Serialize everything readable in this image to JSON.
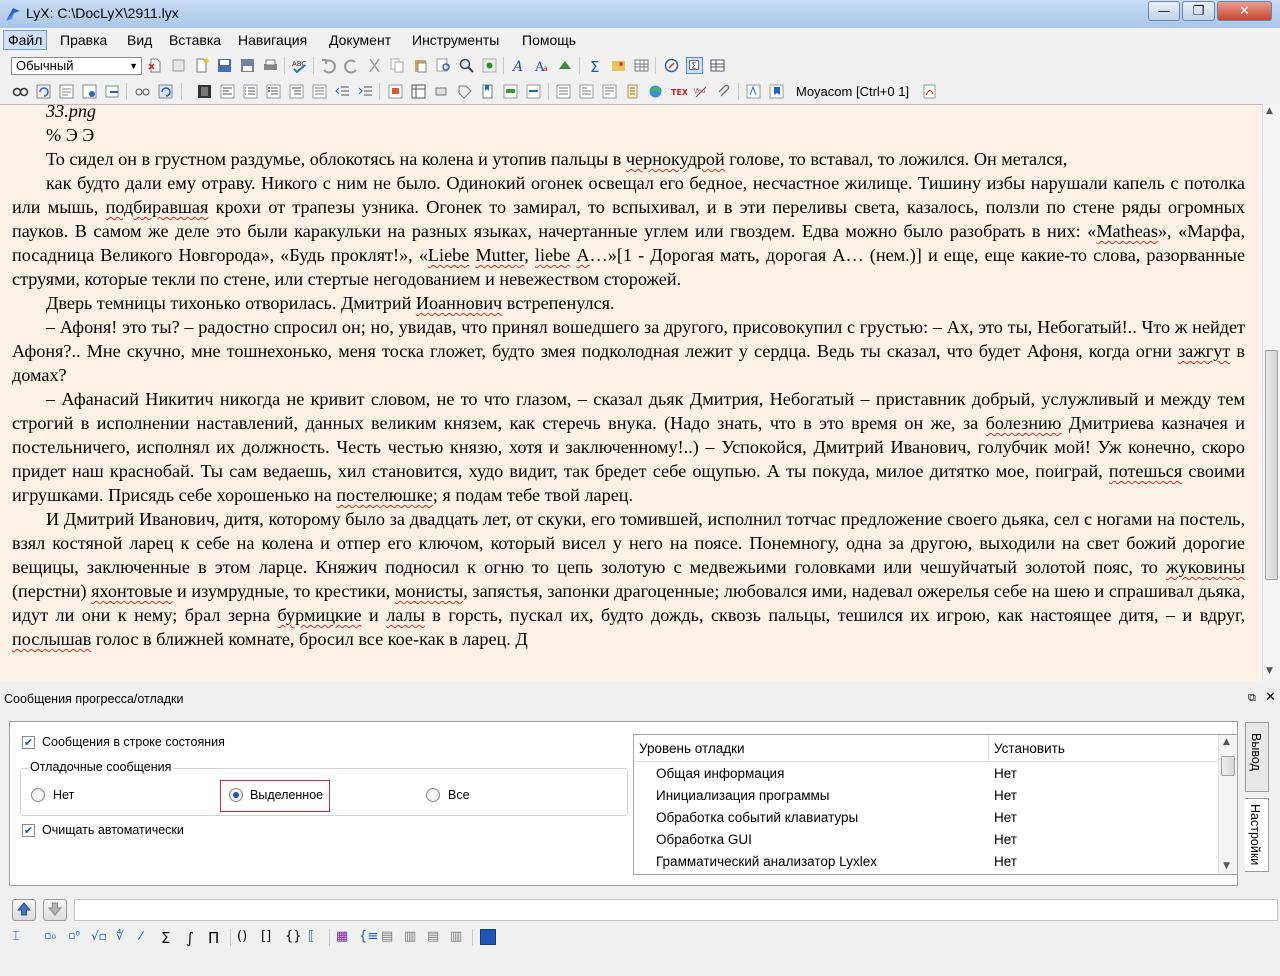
{
  "window": {
    "title": "LyX: C:\\DocLyX\\2911.lyx",
    "minimize": "—",
    "maximize": "❐",
    "close": "✕"
  },
  "menu": [
    "Файл",
    "Правка",
    "Вид",
    "Вставка",
    "Навигация",
    "Документ",
    "Инструменты",
    "Помощь"
  ],
  "toolbar": {
    "style_value": "Обычный",
    "workarea_label": "Moyacom [Ctrl+0 1]"
  },
  "document": {
    "top_partial": "33.png",
    "line2": "% Э Э",
    "p1": [
      "То сидел он в грустном раздумье, облокотясь на колена и утопив пальцы в ",
      "чернокудрой",
      " голове, то вставал, то ложился. Он метался,"
    ],
    "p2": [
      "как будто дали ему отраву. Никого с ним не было. Одинокий огонек освещал его бедное, несчастное жилище. Тишину избы нарушали капель с потолка или мышь, ",
      "подбиравшая",
      " крохи от трапезы узника. Огонек то замирал, то вспыхивал, и в эти переливы света, казалось, ползли по стене ряды огромных пауков. В самом же деле это были каракульки на разных языках, начертанные углем или гвоздем. Едва можно было разобрать в них: «",
      "Matheas",
      "», «Марфа, посадница Великого Новгорода», «Будь проклят!», «",
      "Liebe",
      " ",
      "Mutter",
      ", ",
      "liebe",
      " ",
      "А",
      "…»[1 - Дорогая мать, дорогая А… (нем.)] и еще, еще какие-то слова, разорванные струями, которые текли по стене, или стертые негодованием и невежеством сторожей."
    ],
    "p3": [
      "Дверь темницы тихонько отворилась. Дмитрий ",
      "Иоаннович",
      " встрепенулся."
    ],
    "p4": [
      "– Афоня! это ты? – радостно спросил он; но, увидав, что принял вошедшего за другого, присовокупил с грустью: – Ах, это ты, Небогатый!.. Что ж нейдет Афоня?.. Мне скучно, мне тошнехонько, меня тоска гложет, будто змея подколодная лежит у сердца. Ведь ты сказал, что будет Афоня, когда огни ",
      "зажгут",
      " в домах?"
    ],
    "p5": [
      "– Афанасий Никитич никогда не кривит словом, не то что глазом, – сказал дьяк Дмитрия, Небогатый – приставник добрый, услужливый и между тем строгий в исполнении наставлений, данных великим князем, как стеречь внука. (Надо знать, что в это время он же, за ",
      "болезнию",
      " Дмитриева казначея и постельничего, исполнял их должность. Честь честью князю, хотя и заключенному!..) – Успокойся, Дмитрий Иванович, голубчик мой! Уж конечно, скоро придет наш краснобай. Ты сам ведаешь, хил становится, худо видит, так бредет себе ощупью. А ты покуда, милое дитятко мое, поиграй, ",
      "потешься",
      " своими игрушками. Присядь себе хорошенько на ",
      "постелюшке",
      "; я подам тебе твой ларец."
    ],
    "p6": [
      "И Дмитрий Иванович, дитя, которому было за двадцать лет, от скуки, его томившей, исполнил тотчас предложение своего дьяка, сел с ногами на постель, взял костяной ларец к себе на колена и отпер его ключом, который висел у него на поясе. Понемногу, одна за другою, выходили на свет божий дорогие вещицы, заключенные в этом ларце. Княжич подносил к огню то цепь золотую с медвежьими головками или чешуйчатый золотой пояс, то ",
      "жуковины",
      " (перстни) ",
      "яхонтовые",
      " и изумрудные, то крестики, ",
      "мониcты",
      ", запястья, запонки драгоценные; любовался ими, надевал ожерелья себе на шею и спрашивал дьяка, идут ли они к нему; брал зерна ",
      "бурмицкие",
      " и ",
      "лалы",
      " в горсть, пускал их, будто дождь, сквозь пальцы, тешился их игрою, как настоящее дитя, – и вдруг, ",
      "послышав",
      " голос в ближней комнате, бросил все кое-как в ларец. Д"
    ]
  },
  "panel": {
    "title": "Сообщения прогресса/отладки",
    "status_messages": "Сообщения в строке состояния",
    "group_title": "Отладочные сообщения",
    "radio_none": "Нет",
    "radio_selected": "Выделенное",
    "radio_all": "Все",
    "auto_clear": "Очищать автоматически",
    "table": {
      "col1": "Уровень отладки",
      "col2": "Установить",
      "rows": [
        {
          "level": "Общая информация",
          "value": "Нет"
        },
        {
          "level": "Инициализация программы",
          "value": "Нет"
        },
        {
          "level": "Обработка событий клавиатуры",
          "value": "Нет"
        },
        {
          "level": "Обработка GUI",
          "value": "Нет"
        },
        {
          "level": "Грамматический анализатор Lyxlex",
          "value": "Нет"
        }
      ]
    },
    "tab_output": "Вывод",
    "tab_settings": "Настройки"
  },
  "colors": {
    "doc_bg": "#fbf1e4",
    "spell_underline": "#d23030",
    "highlight_border": "#c0303a"
  }
}
